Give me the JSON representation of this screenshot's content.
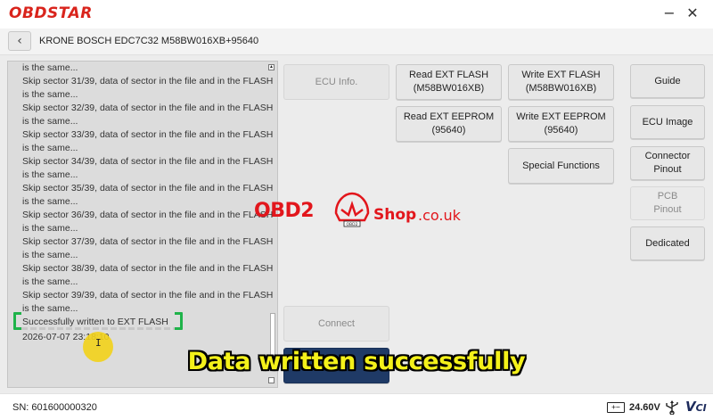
{
  "app": {
    "brand": "OBDSTAR",
    "minimize_icon": "minus-icon",
    "close_icon": "close-icon"
  },
  "header": {
    "back_icon": "chevron-left-icon",
    "title": "KRONE BOSCH EDC7C32 M58BW016XB+95640"
  },
  "log": {
    "lines": [
      "is the same...",
      "Skip sector 31/39, data of sector in the file and in the FLASH",
      "is the same...",
      "Skip sector 32/39, data of sector in the file and in the FLASH",
      "is the same...",
      "Skip sector 33/39, data of sector in the file and in the FLASH",
      "is the same...",
      "Skip sector 34/39, data of sector in the file and in the FLASH",
      "is the same...",
      "Skip sector 35/39, data of sector in the file and in the FLASH",
      "is the same...",
      "Skip sector 36/39, data of sector in the file and in the FLASH",
      "is the same...",
      "Skip sector 37/39, data of sector in the file and in the FLASH",
      "is the same...",
      "Skip sector 38/39, data of sector in the file and in the FLASH",
      "is the same...",
      "Skip sector 39/39, data of sector in the file and in the FLASH",
      "is the same...",
      "Successfully written to EXT FLASH"
    ],
    "timestamp": "2026-07-07 23:18:10"
  },
  "actions": {
    "ecu_info": "ECU Info.",
    "read_ext_flash": [
      "Read EXT FLASH",
      "(M58BW016XB)"
    ],
    "write_ext_flash": [
      "Write EXT FLASH",
      "(M58BW016XB)"
    ],
    "read_ext_eeprom": [
      "Read EXT EEPROM",
      "(95640)"
    ],
    "write_ext_eeprom": [
      "Write EXT EEPROM",
      "(95640)"
    ],
    "special_functions": "Special Functions",
    "connect": "Connect"
  },
  "sidebar": {
    "guide": "Guide",
    "ecu_image": "ECU Image",
    "connector_pinout": [
      "Connector",
      "Pinout"
    ],
    "pcb_pinout": [
      "PCB",
      "Pinout"
    ],
    "dedicated": "Dedicated"
  },
  "watermark": {
    "left": "OBD2",
    "car_plate": "OBD2",
    "right": "Shop",
    "domain": ".co.uk"
  },
  "caption": "Data written successfully",
  "status": {
    "sn": "SN: 601600000320",
    "battery_icon": "battery-icon",
    "voltage": "24.60V",
    "usb_icon": "usb-icon",
    "vci": "VCI"
  },
  "colors": {
    "brand": "#d9241c",
    "highlight": "#1fb34a",
    "caption": "#f4f11a",
    "watermark": "#e2161c"
  }
}
